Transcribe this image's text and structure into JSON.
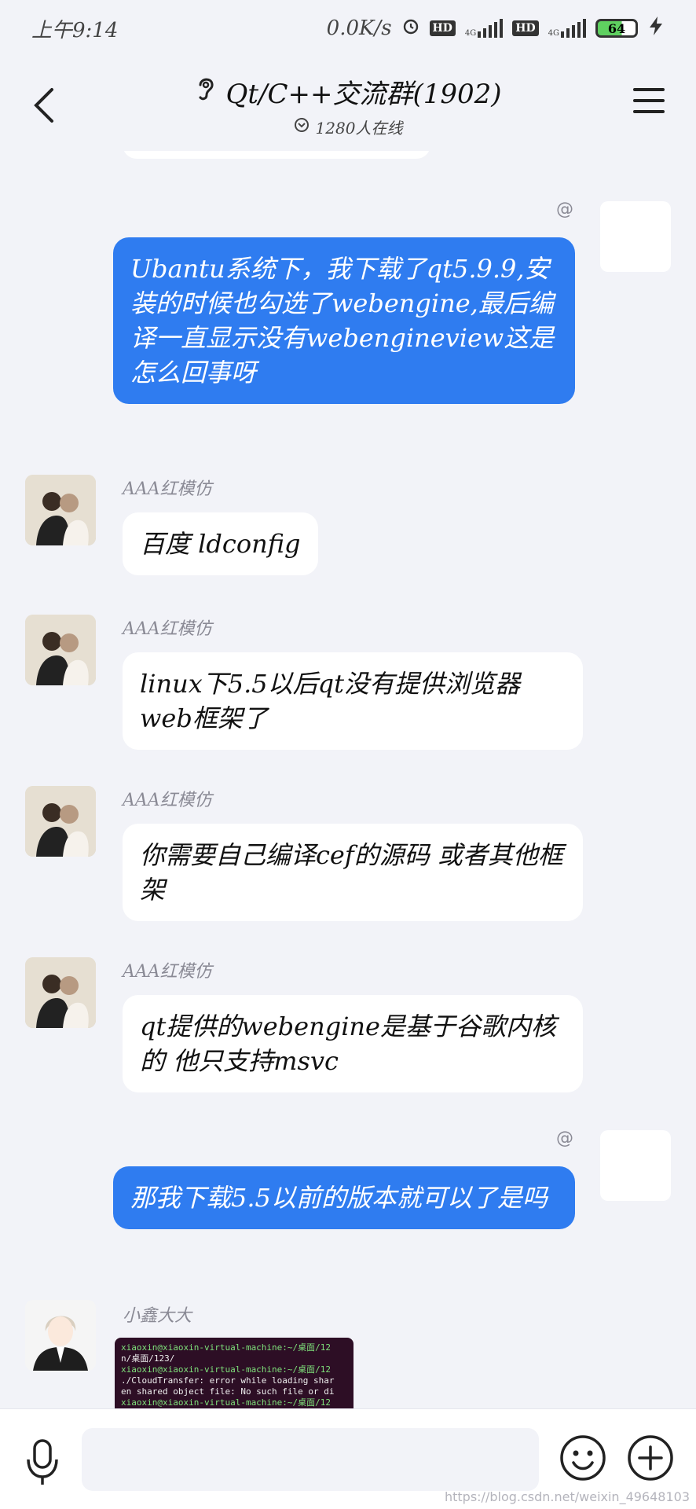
{
  "status_bar": {
    "time": "上午9:14",
    "net_speed": "0.0K/s",
    "hd1": "HD",
    "net1": "4G",
    "hd2": "HD",
    "net2": "4G",
    "battery": "64"
  },
  "header": {
    "title": "Qt/C++交流群(1902)",
    "online_count": "1280人在线"
  },
  "messages": [
    {
      "direction": "out",
      "mention": "@",
      "text": "Ubantu系统下，我下载了qt5.9.9,安装的时候也勾选了webengine,最后编译一直显示没有webengineview这是怎么回事呀"
    },
    {
      "direction": "in",
      "sender": "AAA红模仿",
      "text": "百度 ldconfig"
    },
    {
      "direction": "in",
      "sender": "AAA红模仿",
      "text": "linux下5.5以后qt没有提供浏览器web框架了"
    },
    {
      "direction": "in",
      "sender": "AAA红模仿",
      "text": "你需要自己编译cef的源码 或者其他框架"
    },
    {
      "direction": "in",
      "sender": "AAA红模仿",
      "text": "qt提供的webengine是基于谷歌内核的 他只支持msvc"
    },
    {
      "direction": "out",
      "mention": "@",
      "text": "那我下载5.5以前的版本就可以了是吗"
    },
    {
      "direction": "in",
      "sender": "小鑫大大",
      "image_lines": [
        "xiaoxin@xiaoxin-virtual-machine:~/桌面/12",
        "n/桌面/123/",
        "xiaoxin@xiaoxin-virtual-machine:~/桌面/12",
        "./CloudTransfer: error while loading shar",
        "en shared object file: No such file or di",
        "xiaoxin@xiaoxin-virtual-machine:~/桌面/12"
      ]
    }
  ],
  "watermark": "https://blog.csdn.net/weixin_49648103",
  "colors": {
    "outgoing_bubble": "#2f7cf0",
    "background": "#f2f3f8"
  }
}
